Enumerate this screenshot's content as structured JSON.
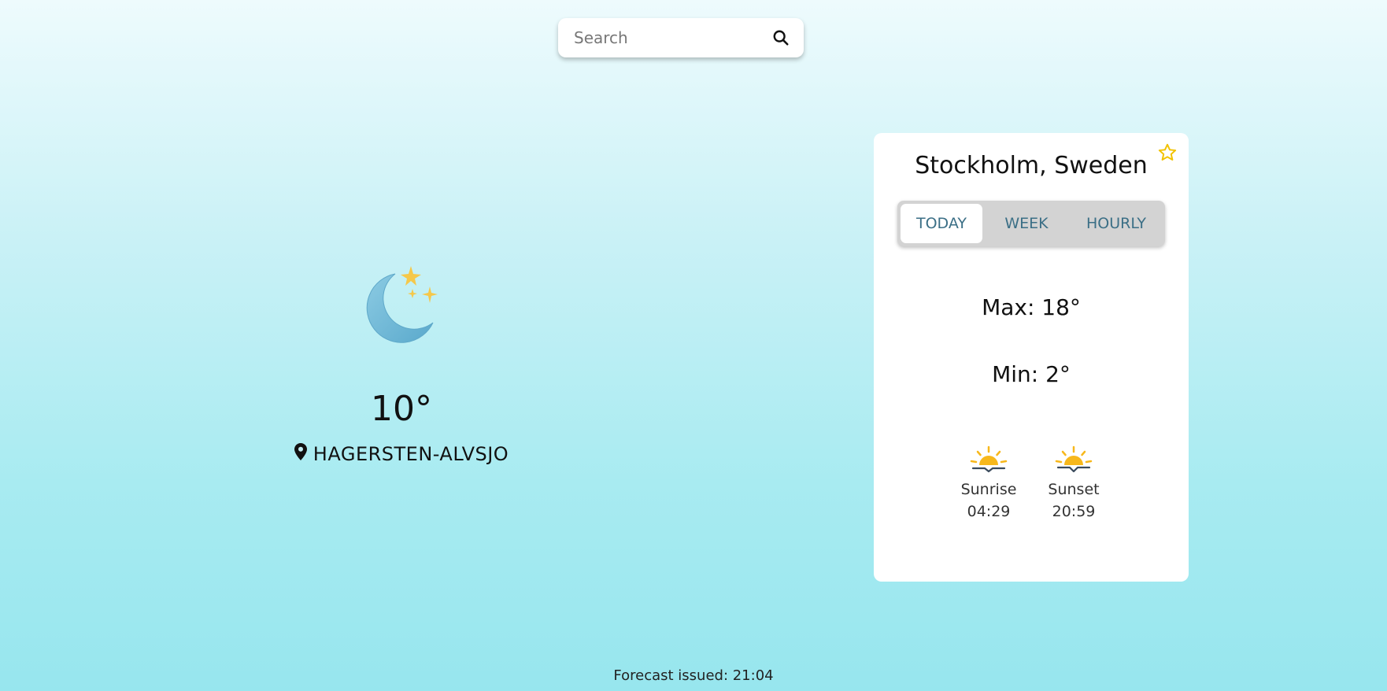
{
  "search": {
    "placeholder": "Search"
  },
  "current": {
    "icon": "moon-stars-icon",
    "temperature": "10°",
    "location": "HAGERSTEN-ALVSJO"
  },
  "card": {
    "city": "Stockholm, Sweden",
    "tabs": [
      {
        "label": "TODAY",
        "active": true
      },
      {
        "label": "WEEK",
        "active": false
      },
      {
        "label": "HOURLY",
        "active": false
      }
    ],
    "max": "Max: 18°",
    "min": "Min: 2°",
    "sunrise": {
      "label": "Sunrise",
      "time": "04:29"
    },
    "sunset": {
      "label": "Sunset",
      "time": "20:59"
    }
  },
  "footer": {
    "text": "Forecast issued: 21:04"
  },
  "colors": {
    "accent_star": "#f2c200",
    "tab_text": "#3b6f86",
    "sun": "#f7b81c",
    "moon": "#6fb9d6"
  }
}
